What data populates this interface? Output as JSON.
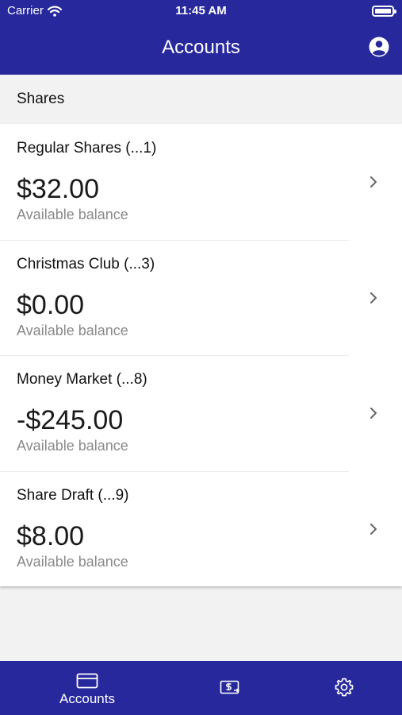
{
  "status_bar": {
    "carrier": "Carrier",
    "time": "11:45 AM"
  },
  "header": {
    "title": "Accounts"
  },
  "section": {
    "label": "Shares"
  },
  "accounts": [
    {
      "name": "Regular Shares (...1)",
      "balance": "$32.00",
      "balance_label": "Available balance"
    },
    {
      "name": "Christmas Club (...3)",
      "balance": "$0.00",
      "balance_label": "Available balance"
    },
    {
      "name": "Money Market (...8)",
      "balance": "-$245.00",
      "balance_label": "Available balance"
    },
    {
      "name": "Share Draft (...9)",
      "balance": "$8.00",
      "balance_label": "Available balance"
    }
  ],
  "tabbar": {
    "accounts_label": "Accounts",
    "accounts_icon": "card-icon",
    "transfer_icon": "transfer-money-icon",
    "settings_icon": "gear-icon"
  },
  "colors": {
    "brand": "#27289b",
    "background": "#f2f2f2",
    "secondary_text": "#8a8a8a"
  }
}
